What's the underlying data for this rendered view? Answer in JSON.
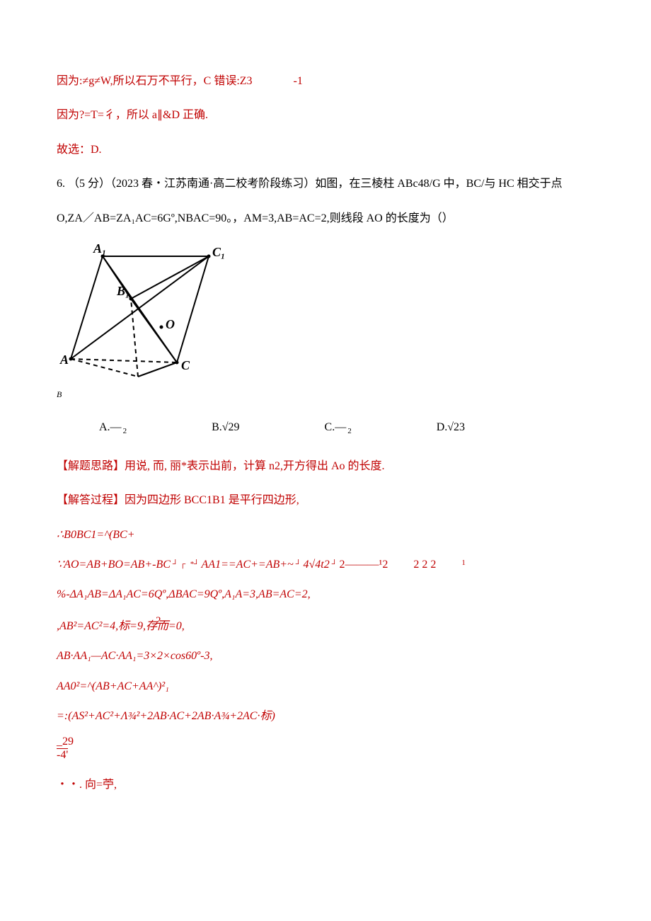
{
  "line1_pre": "因为:≠g≠W,所以石万不平行，C 错误:Z3",
  "line1_post": "-1",
  "line2": "因为?=T=彳，所以 a∥&D 正确.",
  "line3": "故选：D.",
  "q6_a": "6. （5 分）（2023 春・江苏南通·高二校考阶段练习）如图，在三棱柱 ABc48/G 中，BC/与 HC 相交于点",
  "q6_b": "O,ZA／AB=ZA₁AC=6Gº,NBAC=90。，AM=3,AB=AC=2,则线段 AO 的长度为（）",
  "labelB": "B",
  "choices": {
    "A": "A.—",
    "Asub": "2",
    "B": "B.√29",
    "C": "C.—",
    "Csub": "2",
    "D": "D.√23"
  },
  "sol1": "【解题思路】用说, 而, 丽*表示出前，计算 n2,开方得出 Ao 的长度.",
  "sol2": "【解答过程】因为四边形 BCC1B1 是平行四边形,",
  "eq1": "∴B0BC1=^(BC+",
  "eq2_a": "∵AO=AB+BO=AB+-BC",
  "eq2_b": "AA1==AC+=AB+~",
  "eq2_c": "4√4t2",
  "eq2_trail": "2          2          2",
  "eq2_trail_end": "1",
  "eq3": "%-ΔA₁AB=ΔA₁AC=6Qº,ΔBAC=9Qº,A₁A=3,AB=AC=2,",
  "eq4_top": "2",
  "eq4": ",AB²=AC²=4,标=9,存而=0,",
  "eq5": "AB·AA₁—AC·AA₁=3×2×cos60º-3,",
  "eq6": "AA0²=^(AB+AC+AA^)²₁",
  "eq7": "=:(AS²+AC²+Λ¾²+2AB·AC+2AB·A¾+2AC·标)",
  "eq8_t": "_29",
  "eq8_b": "-4'",
  "eq9": "・・. 向=苧,",
  "figure_labels": {
    "A1": "A₁",
    "C1": "C₁",
    "B1": "B₁",
    "O": "O",
    "A": "A",
    "C": "C"
  }
}
